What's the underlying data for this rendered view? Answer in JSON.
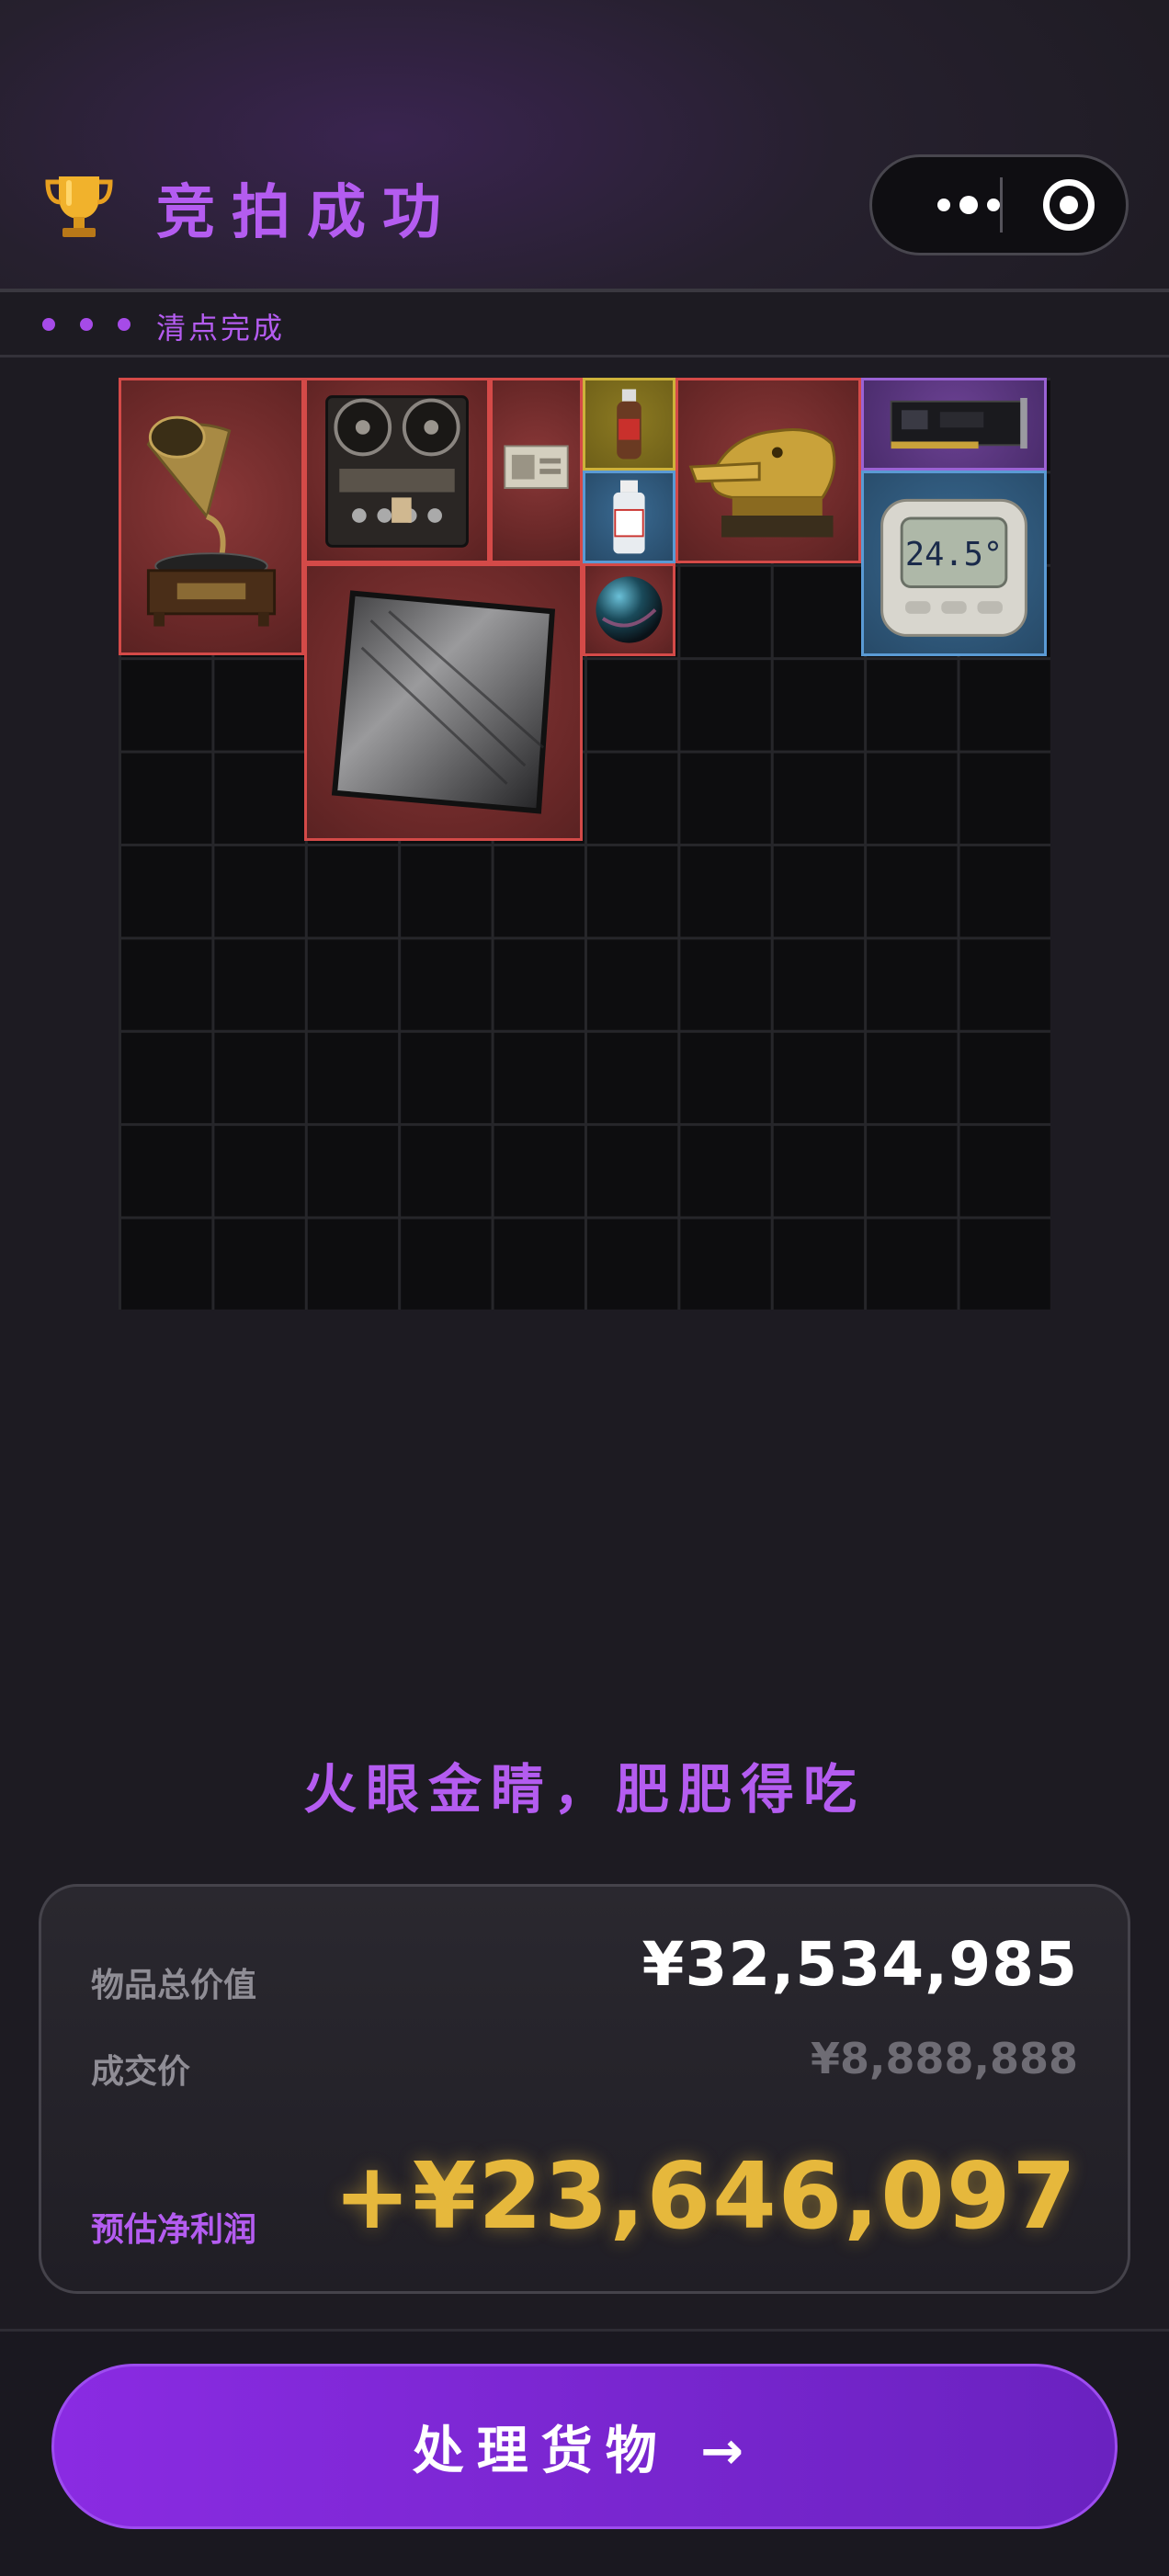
{
  "header": {
    "title": "竞拍成功",
    "trophy_icon": "trophy-icon"
  },
  "capsule": {
    "more_icon": "more-dots-icon",
    "close_icon": "target-icon"
  },
  "status": {
    "label": "清点完成"
  },
  "grid": {
    "columns": 10,
    "rows": 10,
    "items": [
      {
        "name": "gramophone",
        "rarity": "red"
      },
      {
        "name": "reel-to-reel-tape-recorder",
        "rarity": "red"
      },
      {
        "name": "banknote",
        "rarity": "red"
      },
      {
        "name": "small-bottle",
        "rarity": "gold"
      },
      {
        "name": "golden-crocodile-head-statue",
        "rarity": "red"
      },
      {
        "name": "sound-card",
        "rarity": "purple"
      },
      {
        "name": "medicine-bottle",
        "rarity": "blue"
      },
      {
        "name": "digital-thermometer",
        "rarity": "blue",
        "display": "24.5°"
      },
      {
        "name": "carbon-fiber-plate",
        "rarity": "red"
      },
      {
        "name": "iridescent-orb",
        "rarity": "red"
      }
    ]
  },
  "slogan": "火眼金睛，肥肥得吃",
  "summary": {
    "total_label": "物品总价值",
    "total_value": "¥32,534,985",
    "deal_label": "成交价",
    "deal_value": "¥8,888,888",
    "profit_label": "预估净利润",
    "profit_value": "+¥23,646,097"
  },
  "action": {
    "label": "处理货物 →"
  },
  "colors": {
    "accent": "#b45cf0",
    "profit": "#e6b83c",
    "rarity_red": "#d44a48",
    "rarity_gold": "#cdb23a",
    "rarity_blue": "#5a9ad4",
    "rarity_purple": "#9a62d4"
  }
}
